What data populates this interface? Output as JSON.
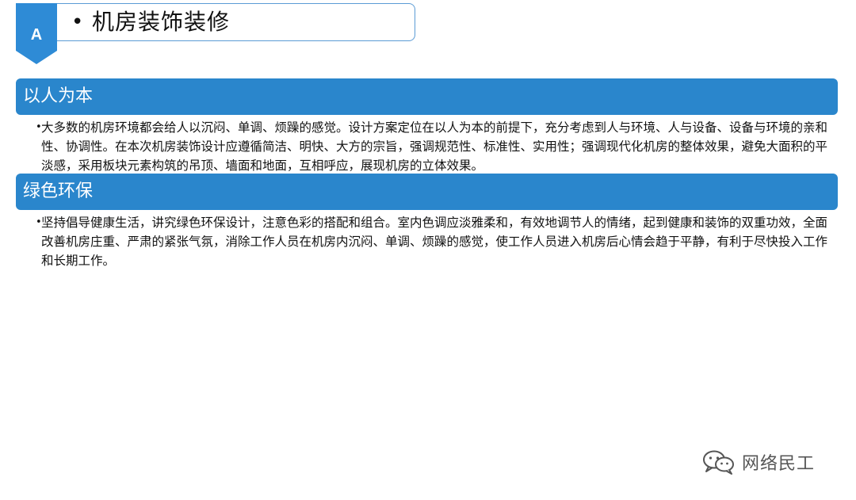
{
  "title": {
    "badge_letter": "A",
    "bullet": "•",
    "text": "机房装饰装修"
  },
  "sections": [
    {
      "heading": "以人为本",
      "bullet": "•",
      "body": "大多数的机房环境都会给人以沉闷、单调、烦躁的感觉。设计方案定位在以人为本的前提下，充分考虑到人与环境、人与设备、设备与环境的亲和性、协调性。在本次机房装饰设计应遵循简洁、明快、大方的宗旨，强调规范性、标准性、实用性；强调现代化机房的整体效果，避免大面积的平淡感，采用板块元素构筑的吊顶、墙面和地面，互相呼应，展现机房的立体效果。"
    },
    {
      "heading": "绿色环保",
      "bullet": "•",
      "body": "坚持倡导健康生活，讲究绿色环保设计，注意色彩的搭配和组合。室内色调应淡雅柔和，有效地调节人的情绪，起到健康和装饰的双重功效，全面改善机房庄重、严肃的紧张气氛，消除工作人员在机房内沉闷、单调、烦躁的感觉，使工作人员进入机房后心情会趋于平静，有利于尽快投入工作和长期工作。"
    }
  ],
  "watermark": {
    "icon": "wechat-icon",
    "text": "网络民工"
  },
  "colors": {
    "header_blue": "#2a86cc",
    "badge_blue": "#2e8bd6",
    "title_border": "#5b9bd5",
    "watermark_gray": "#555555"
  }
}
